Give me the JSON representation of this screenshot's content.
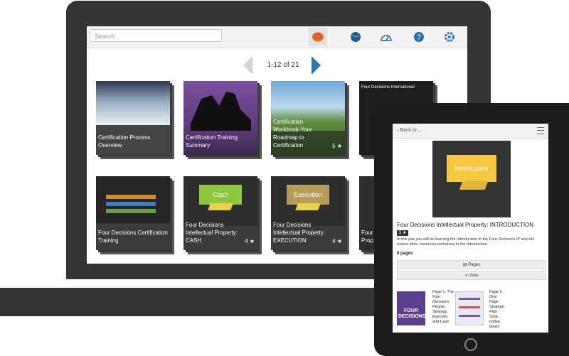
{
  "search": {
    "placeholder": "Search"
  },
  "toolbar": {
    "icons": [
      "brain-icon",
      "globe-icon",
      "gauge-icon",
      "help-icon",
      "gear-icon"
    ]
  },
  "pager": {
    "label": "1-12 of 21"
  },
  "cards": [
    {
      "title": "Certification Process Overview",
      "rating": ""
    },
    {
      "title": "Certification Training Summary",
      "rating": ""
    },
    {
      "title": "Certification Workbook-Your Roadmap to Certification",
      "rating": "5 ★"
    },
    {
      "title": "Four Decisions International",
      "rating": ""
    },
    {
      "title": "Four Decisions Certification Training",
      "rating": ""
    },
    {
      "title": "Four Decisions Intellectual Property: CASH",
      "ribbon": "Cash",
      "rating": "4 ★"
    },
    {
      "title": "Four Decisions Intellectual Property: EXECUTION",
      "ribbon": "Execution",
      "rating": "4 ★"
    },
    {
      "title": "Four Prop",
      "rating": ""
    }
  ],
  "tablet": {
    "back_label": "Back to ...",
    "hero_label": "Introduction",
    "title": "Four Decisions Intellectual Property: INTRODUCTION",
    "badge": "5 ★",
    "description": "In this pak you will be learning the Introduction to the Four Decisions IP and will review other resources pertaining to the Introduction.",
    "pages_count": "8 pages",
    "pages_button": "Pages",
    "view_button": "View",
    "page1": {
      "label": "Page 1. The Four Decisions People, Strategy, Executio and Cash",
      "thumb": "FOUR DECISIONS"
    },
    "page2": {
      "label": "Page 2. One Page Strategic Plan Vook (video book)"
    }
  },
  "colors": {
    "frame": "#333435",
    "accent_blue": "#2b78b5",
    "ribbon_yellow": "#f5c842"
  }
}
